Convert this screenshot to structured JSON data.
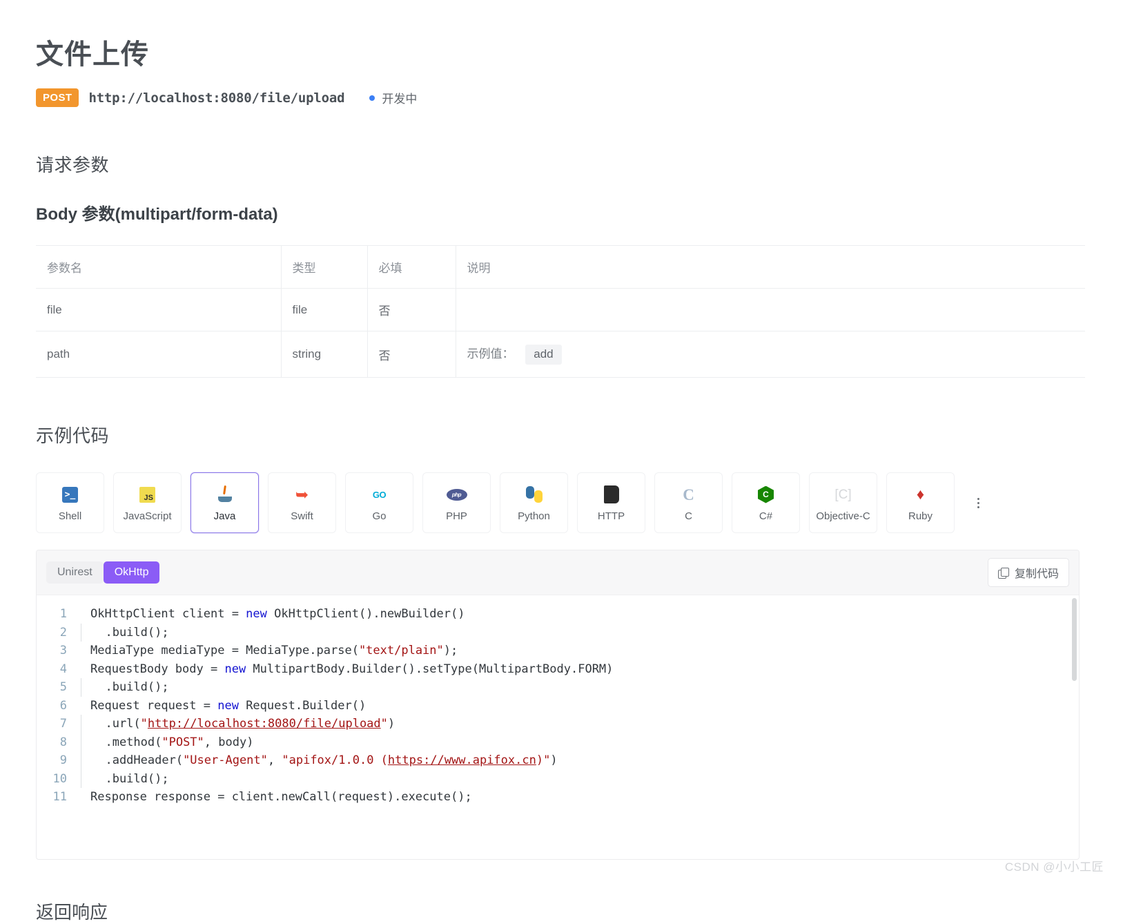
{
  "header": {
    "title": "文件上传",
    "method": "POST",
    "url": "http://localhost:8080/file/upload",
    "status": "开发中"
  },
  "sections": {
    "request_params": "请求参数",
    "body_params": "Body 参数(multipart/form-data)",
    "sample_code": "示例代码",
    "response": "返回响应"
  },
  "params_table": {
    "columns": [
      "参数名",
      "类型",
      "必填",
      "说明"
    ],
    "rows": [
      {
        "name": "file",
        "type": "file",
        "required": "否",
        "desc_label": "",
        "desc_value": ""
      },
      {
        "name": "path",
        "type": "string",
        "required": "否",
        "desc_label": "示例值：",
        "desc_value": "add"
      }
    ]
  },
  "lang_tabs": [
    {
      "label": "Shell",
      "icon": "powershell-icon",
      "active": false
    },
    {
      "label": "JavaScript",
      "icon": "javascript-icon",
      "active": false
    },
    {
      "label": "Java",
      "icon": "java-icon",
      "active": true
    },
    {
      "label": "Swift",
      "icon": "swift-icon",
      "active": false
    },
    {
      "label": "Go",
      "icon": "go-icon",
      "active": false
    },
    {
      "label": "PHP",
      "icon": "php-icon",
      "active": false
    },
    {
      "label": "Python",
      "icon": "python-icon",
      "active": false
    },
    {
      "label": "HTTP",
      "icon": "http-icon",
      "active": false
    },
    {
      "label": "C",
      "icon": "c-icon",
      "active": false
    },
    {
      "label": "C#",
      "icon": "csharp-icon",
      "active": false
    },
    {
      "label": "Objective-C",
      "icon": "objective-c-icon",
      "active": false
    },
    {
      "label": "Ruby",
      "icon": "ruby-icon",
      "active": false
    }
  ],
  "code_panel": {
    "subtabs": [
      {
        "label": "Unirest",
        "active": false
      },
      {
        "label": "OkHttp",
        "active": true
      }
    ],
    "copy_label": "复制代码",
    "line_numbers": [
      "1",
      "2",
      "3",
      "4",
      "5",
      "6",
      "7",
      "8",
      "9",
      "10",
      "11"
    ],
    "lines": [
      "OkHttpClient client = new OkHttpClient().newBuilder()",
      "  .build();",
      "MediaType mediaType = MediaType.parse(\"text/plain\");",
      "RequestBody body = new MultipartBody.Builder().setType(MultipartBody.FORM)",
      "  .build();",
      "Request request = new Request.Builder()",
      "  .url(\"http://localhost:8080/file/upload\")",
      "  .method(\"POST\", body)",
      "  .addHeader(\"User-Agent\", \"apifox/1.0.0 (https://www.apifox.cn)\")",
      "  .build();",
      "Response response = client.newCall(request).execute();"
    ]
  },
  "colors": {
    "method_badge": "#f2962d",
    "status_dot": "#3b7ff5",
    "active_tab_border": "#8a77e8",
    "active_subtab": "#8b5cf6",
    "keyword": "#1414d1",
    "string": "#a31515",
    "line_number": "#8aa5b8"
  },
  "watermark": "CSDN @小小工匠"
}
